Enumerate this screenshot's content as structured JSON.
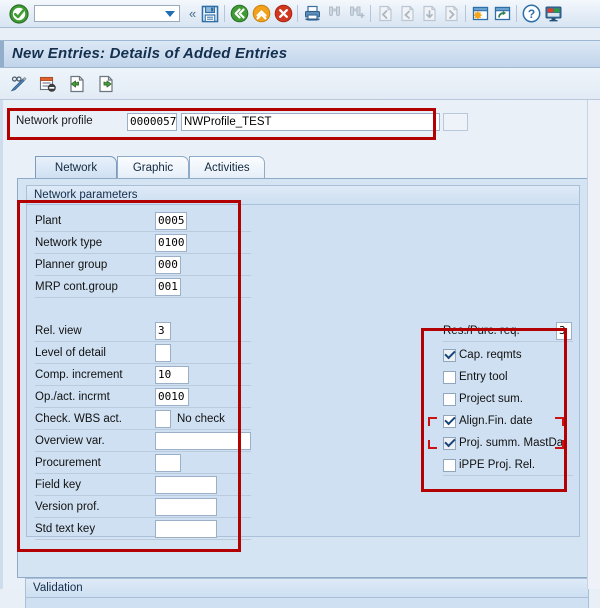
{
  "window": {
    "title": "New Entries: Details of Added Entries"
  },
  "toolbar": {
    "command_field_value": "",
    "command_field_placeholder": "",
    "items": [
      {
        "name": "enter-ok-icon",
        "label": "Enter"
      },
      {
        "name": "command-field",
        "label": ""
      },
      {
        "name": "more-chevrons-icon",
        "label": "More"
      },
      {
        "name": "save-icon",
        "label": "Save"
      },
      {
        "name": "back-icon",
        "label": "Back"
      },
      {
        "name": "exit-icon",
        "label": "Exit"
      },
      {
        "name": "cancel-icon",
        "label": "Cancel"
      },
      {
        "name": "print-icon",
        "label": "Print"
      },
      {
        "name": "find-icon",
        "label": "Find"
      },
      {
        "name": "find-next-icon",
        "label": "Find Next"
      },
      {
        "name": "first-page-icon",
        "label": "First Page"
      },
      {
        "name": "previous-page-icon",
        "label": "Previous Page"
      },
      {
        "name": "next-page-icon",
        "label": "Next Page"
      },
      {
        "name": "last-page-icon",
        "label": "Last Page"
      },
      {
        "name": "create-session-icon",
        "label": "Create Session"
      },
      {
        "name": "create-shortcut-icon",
        "label": "Create Shortcut"
      },
      {
        "name": "help-icon",
        "label": "Help"
      },
      {
        "name": "customize-layout-icon",
        "label": "Customize Local Layout"
      }
    ]
  },
  "app_toolbar": {
    "items": [
      {
        "name": "display-change-icon",
        "label": "Display <-> Change"
      },
      {
        "name": "delete-entry-icon",
        "label": "Delete Entry"
      },
      {
        "name": "previous-entry-icon",
        "label": "Previous Entry"
      },
      {
        "name": "next-entry-icon",
        "label": "Next Entry"
      }
    ]
  },
  "header_field": {
    "label": "Network profile",
    "key_value": "0000057",
    "text_value": "NWProfile_TEST",
    "extra_value": ""
  },
  "tabs": [
    {
      "label": "Network",
      "selected": true
    },
    {
      "label": "Graphic",
      "selected": false
    },
    {
      "label": "Activities",
      "selected": false
    }
  ],
  "network_parameters": {
    "group_title": "Network parameters",
    "left_fields": [
      {
        "label": "Plant",
        "value": "0005"
      },
      {
        "label": "Network type",
        "value": "0100"
      },
      {
        "label": "Planner group",
        "value": "000"
      },
      {
        "label": "MRP cont.group",
        "value": "001"
      },
      {
        "label": "Rel. view",
        "value": "3"
      },
      {
        "label": "Level of detail",
        "value": ""
      },
      {
        "label": "Comp. increment",
        "value": "10"
      },
      {
        "label": "Op./act. incrmt",
        "value": "0010"
      },
      {
        "label": "Check. WBS act.",
        "value": "",
        "suffix": "No check"
      },
      {
        "label": "Overview var.",
        "value": ""
      },
      {
        "label": "Procurement",
        "value": ""
      },
      {
        "label": "Field key",
        "value": ""
      },
      {
        "label": "Version prof.",
        "value": ""
      },
      {
        "label": "Std text key",
        "value": ""
      }
    ],
    "right_field": {
      "label": "Res./Purc. req.",
      "value": "3"
    },
    "right_checkboxes": [
      {
        "label": "Cap. reqmts",
        "checked": true,
        "enabled": false
      },
      {
        "label": "Entry tool",
        "checked": false,
        "enabled": true
      },
      {
        "label": "Project sum.",
        "checked": false,
        "enabled": true
      },
      {
        "label": "Align.Fin. date",
        "checked": true,
        "enabled": true
      },
      {
        "label": "Proj. summ. MastDa",
        "checked": true,
        "enabled": false
      },
      {
        "label": "iPPE Proj. Rel.",
        "checked": false,
        "enabled": true
      }
    ]
  },
  "validation": {
    "group_title": "Validation"
  },
  "annotations": {
    "highlight_color": "#b30000",
    "marker_color": "#cc1111",
    "boxes": [
      {
        "name": "header-field-highlight",
        "target": "Network profile row"
      },
      {
        "name": "left-parameters-highlight",
        "target": "Network parameters left column"
      },
      {
        "name": "right-checkbox-highlight",
        "target": "Res./Purc. req. and checkbox block"
      },
      {
        "name": "align-fin-date-marker",
        "target": "Align.Fin. date checkbox"
      }
    ]
  }
}
